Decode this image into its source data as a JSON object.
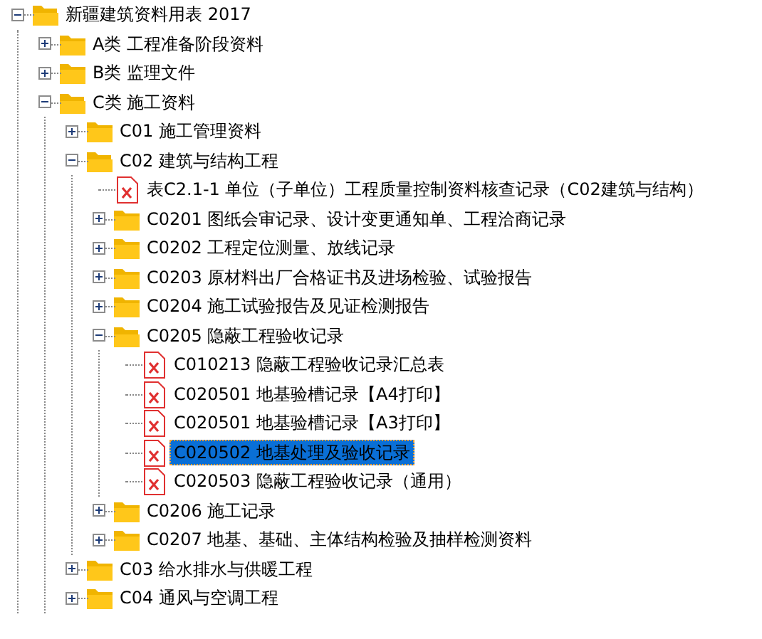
{
  "tree": [
    {
      "label": "新疆建筑资料用表 2017",
      "kind": "folder",
      "expanded": true,
      "selected": false,
      "children": [
        {
          "label": "A类 工程准备阶段资料",
          "kind": "folder",
          "expanded": false,
          "selected": false
        },
        {
          "label": "B类 监理文件",
          "kind": "folder",
          "expanded": false,
          "selected": false
        },
        {
          "label": "C类 施工资料",
          "kind": "folder",
          "expanded": true,
          "selected": false,
          "children": [
            {
              "label": "C01 施工管理资料",
              "kind": "folder",
              "expanded": false,
              "selected": false
            },
            {
              "label": "C02 建筑与结构工程",
              "kind": "folder",
              "expanded": true,
              "selected": false,
              "children": [
                {
                  "label": "表C2.1-1 单位（子单位）工程质量控制资料核查记录（C02建筑与结构）",
                  "kind": "file",
                  "selected": false
                },
                {
                  "label": "C0201 图纸会审记录、设计变更通知单、工程洽商记录",
                  "kind": "folder",
                  "expanded": false,
                  "selected": false
                },
                {
                  "label": "C0202 工程定位测量、放线记录",
                  "kind": "folder",
                  "expanded": false,
                  "selected": false
                },
                {
                  "label": "C0203 原材料出厂合格证书及进场检验、试验报告",
                  "kind": "folder",
                  "expanded": false,
                  "selected": false
                },
                {
                  "label": "C0204 施工试验报告及见证检测报告",
                  "kind": "folder",
                  "expanded": false,
                  "selected": false
                },
                {
                  "label": "C0205 隐蔽工程验收记录",
                  "kind": "folder",
                  "expanded": true,
                  "selected": false,
                  "children": [
                    {
                      "label": "C010213 隐蔽工程验收记录汇总表",
                      "kind": "file",
                      "selected": false
                    },
                    {
                      "label": "C020501 地基验槽记录【A4打印】",
                      "kind": "file",
                      "selected": false
                    },
                    {
                      "label": "C020501 地基验槽记录【A3打印】",
                      "kind": "file",
                      "selected": false
                    },
                    {
                      "label": "C020502 地基处理及验收记录",
                      "kind": "file",
                      "selected": true
                    },
                    {
                      "label": "C020503 隐蔽工程验收记录（通用）",
                      "kind": "file",
                      "selected": false
                    }
                  ]
                },
                {
                  "label": "C0206 施工记录",
                  "kind": "folder",
                  "expanded": false,
                  "selected": false
                },
                {
                  "label": "C0207 地基、基础、主体结构检验及抽样检测资料",
                  "kind": "folder",
                  "expanded": false,
                  "selected": false
                }
              ]
            },
            {
              "label": "C03 给水排水与供暖工程",
              "kind": "folder",
              "expanded": false,
              "selected": false
            },
            {
              "label": "C04 通风与空调工程",
              "kind": "folder",
              "expanded": false,
              "selected": false
            }
          ]
        }
      ]
    }
  ]
}
